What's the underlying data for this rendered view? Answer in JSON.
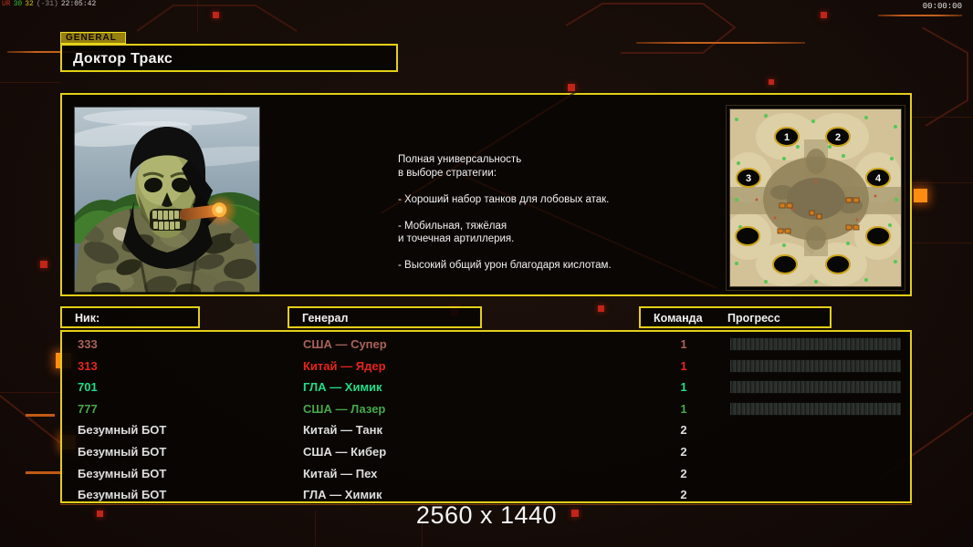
{
  "colors": {
    "accent": "#e3cf17",
    "orange": "#ff8c12",
    "decor_red": "#c22418"
  },
  "debug_overlay": {
    "segments": [
      {
        "text": "UR",
        "color": "#c03020"
      },
      {
        "text": "30",
        "color": "#38c038"
      },
      {
        "text": "32",
        "color": "#c8c022"
      },
      {
        "text": "(-31)",
        "color": "#8a8a8a"
      },
      {
        "text": "22:05:42",
        "color": "#cfcfcf"
      }
    ]
  },
  "rec_timer": "00:00:00",
  "header": {
    "tab_label": "GENERAL",
    "general_name": "Доктор Тракс"
  },
  "description": {
    "lines": [
      "Полная универсальность",
      "в выборе стратегии:",
      "",
      "- Хороший набор танков для лобовых атак.",
      "",
      "- Мобильная, тяжёлая",
      "и точечная артиллерия.",
      "",
      "- Высокий общий урон благодаря кислотам."
    ]
  },
  "map_preview": {
    "start_positions": [
      "1",
      "2",
      "3",
      "4"
    ]
  },
  "roster": {
    "columns": {
      "nick": "Ник:",
      "general": "Генерал",
      "team": "Команда",
      "progress": "Прогресс"
    },
    "players": [
      {
        "nick": "333",
        "general": "США — Супер",
        "team": "1",
        "color": "#a8625a",
        "progress": 0
      },
      {
        "nick": "313",
        "general": "Китай — Ядер",
        "team": "1",
        "color": "#e5251a",
        "progress": 0
      },
      {
        "nick": "701",
        "general": "ГЛА — Химик",
        "team": "1",
        "color": "#21dd87",
        "progress": 0
      },
      {
        "nick": "777",
        "general": "США — Лазер",
        "team": "1",
        "color": "#46a84b",
        "progress": 0
      },
      {
        "nick": "Безумный БОТ",
        "general": "Китай — Танк",
        "team": "2",
        "color": "#dedede",
        "progress": null
      },
      {
        "nick": "Безумный БОТ",
        "general": "США — Кибер",
        "team": "2",
        "color": "#dedede",
        "progress": null
      },
      {
        "nick": "Безумный БОТ",
        "general": "Китай — Пех",
        "team": "2",
        "color": "#dedede",
        "progress": null
      },
      {
        "nick": "Безумный БОТ",
        "general": "ГЛА — Химик",
        "team": "2",
        "color": "#dedede",
        "progress": null
      }
    ]
  },
  "footer": {
    "resolution_label": "2560 x 1440"
  }
}
